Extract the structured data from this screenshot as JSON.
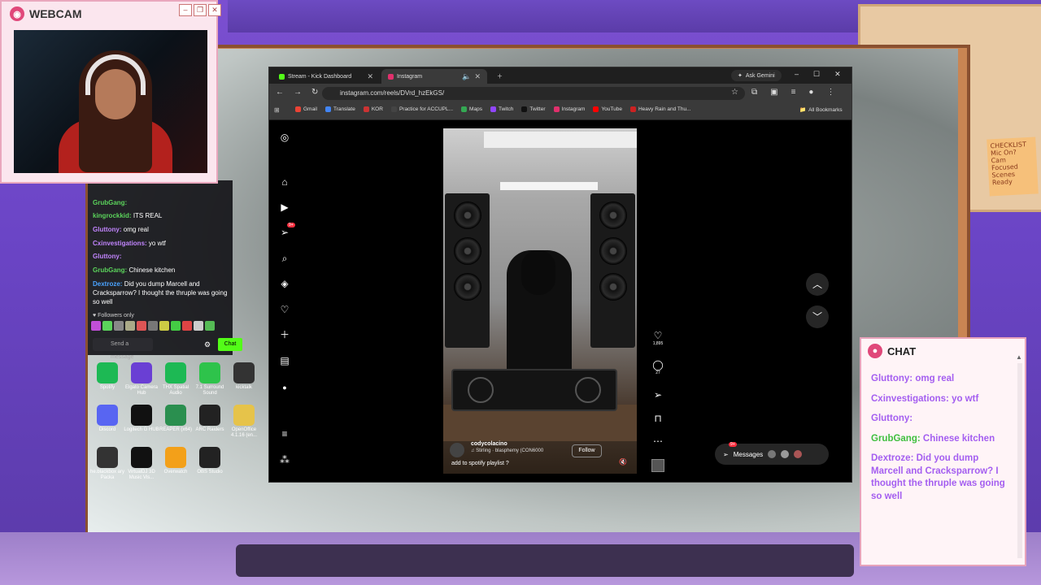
{
  "webcam": {
    "title": "WEBCAM"
  },
  "left_chat": {
    "messages": [
      {
        "user": "GrubGang:",
        "text": "",
        "color": "#5bd35b"
      },
      {
        "user": "kingrockkid:",
        "text": "ITS REAL",
        "color": "#5bd35b"
      },
      {
        "user": "Gluttony:",
        "text": "omg real",
        "color": "#c084fc"
      },
      {
        "user": "Cxinvestigations:",
        "text": "yo wtf",
        "color": "#c084fc"
      },
      {
        "user": "Gluttony:",
        "text": "",
        "color": "#c084fc"
      },
      {
        "user": "GrubGang:",
        "text": "Chinese kitchen",
        "color": "#5bd35b"
      },
      {
        "user": "Dextroze:",
        "text": "Did you dump Marcell and Cracksparrow? I thought the thruple was going so well",
        "color": "#4aa3ff"
      }
    ],
    "followers_only": "Followers only",
    "send_placeholder": "Send a message",
    "chat_button": "Chat"
  },
  "desktop_icons": [
    {
      "label": "Spotify",
      "color": "#1db954"
    },
    {
      "label": "Elgato Camera Hub",
      "color": "#6a3fd4"
    },
    {
      "label": "THX Spatial Audio",
      "color": "#1db954"
    },
    {
      "label": "7.1 Surround Sound",
      "color": "#2ec34b"
    },
    {
      "label": "kicktalk",
      "color": "#333"
    },
    {
      "label": "Discord",
      "color": "#5865f2"
    },
    {
      "label": "Logitech G HUB",
      "color": "#111"
    },
    {
      "label": "REAPER (x64)",
      "color": "#2a8f4f"
    },
    {
      "label": "ARC Raiders",
      "color": "#222"
    },
    {
      "label": "OpenOffice 4.1.16 (en...",
      "color": "#e6c34a"
    },
    {
      "label": "he.blackbox ary Packa",
      "color": "#333"
    },
    {
      "label": "VirtualDJ 3D Music Vis...",
      "color": "#111"
    },
    {
      "label": "Overwatch",
      "color": "#f3a019"
    },
    {
      "label": "OBS Studio",
      "color": "#222"
    }
  ],
  "browser": {
    "tabs": [
      {
        "label": "Stream - Kick Dashboard",
        "active": false
      },
      {
        "label": "Instagram",
        "active": true
      }
    ],
    "ask_gemini": "Ask Gemini",
    "url": "instagram.com/reels/DVrd_hzEkGS/",
    "bookmarks": [
      {
        "label": "Gmail",
        "color": "#ea4335"
      },
      {
        "label": "Translate",
        "color": "#4285f4"
      },
      {
        "label": "KOR",
        "color": "#c33"
      },
      {
        "label": "Practice for ACCUPL...",
        "color": "#444"
      },
      {
        "label": "Maps",
        "color": "#34a853"
      },
      {
        "label": "Twitch",
        "color": "#9146ff"
      },
      {
        "label": "Twitter",
        "color": "#111"
      },
      {
        "label": "Instagram",
        "color": "#e1306c"
      },
      {
        "label": "YouTube",
        "color": "#f00"
      },
      {
        "label": "Heavy Rain and Thu...",
        "color": "#c22"
      }
    ],
    "all_bookmarks": "All Bookmarks"
  },
  "instagram": {
    "notif_badge": "9+",
    "reel": {
      "username": "codycolacino",
      "audio": "Stirling · blasphemy (CON6000",
      "follow": "Follow",
      "caption": "add to spotify playlist ?"
    },
    "likes": "1,895",
    "comments": "27",
    "messages_label": "Messages",
    "messages_badge": "9+"
  },
  "right_chat": {
    "title": "CHAT",
    "messages": [
      {
        "user": "Gluttony:",
        "text": "omg real",
        "ucolor": "#a45ef0",
        "tcolor": "#a45ef0"
      },
      {
        "user": "Cxinvestigations:",
        "text": "yo wtf",
        "ucolor": "#a45ef0",
        "tcolor": "#a45ef0"
      },
      {
        "user": "Gluttony:",
        "text": "",
        "ucolor": "#a45ef0",
        "tcolor": "#a45ef0"
      },
      {
        "user": "GrubGang:",
        "text": "Chinese kitchen",
        "ucolor": "#3fbf3f",
        "tcolor": "#a45ef0"
      },
      {
        "user": "Dextroze:",
        "text": "Did you dump Marcell and Cracksparrow? I thought the thruple was going so well",
        "ucolor": "#a45ef0",
        "tcolor": "#a45ef0"
      }
    ]
  }
}
